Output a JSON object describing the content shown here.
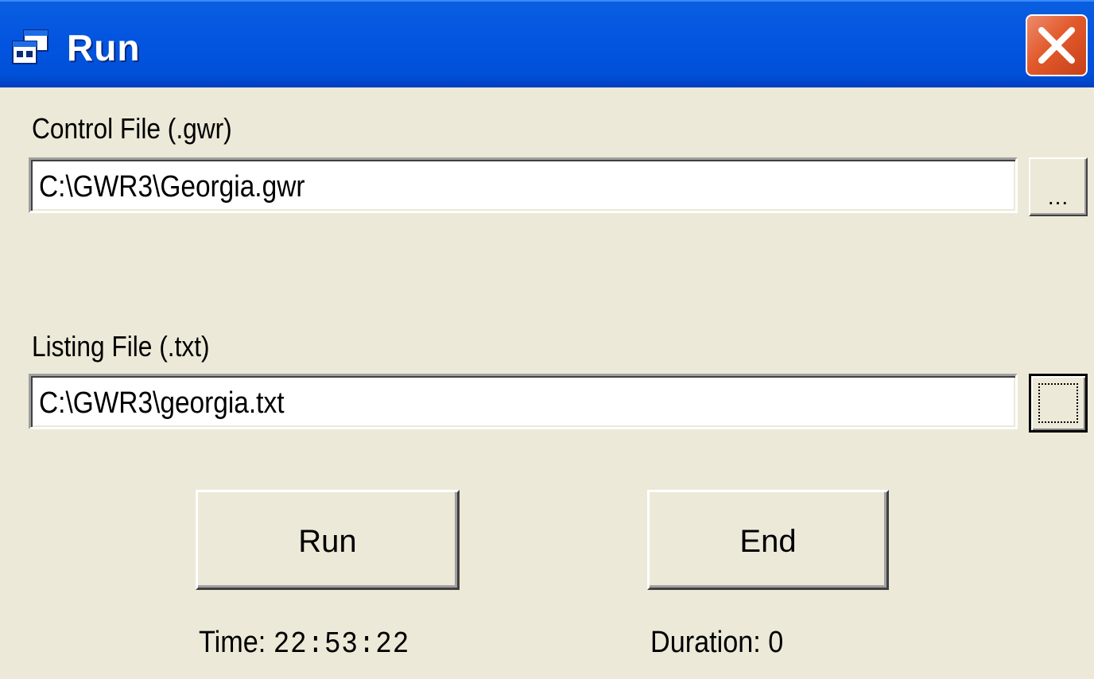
{
  "window": {
    "title": "Run",
    "icon": "app-window-icon",
    "close_icon": "close-icon"
  },
  "control_file": {
    "label": "Control File (.gwr)",
    "value": "C:\\GWR3\\Georgia.gwr",
    "browse_label": "..."
  },
  "listing_file": {
    "label": "Listing File (.txt)",
    "value": "C:\\GWR3\\georgia.txt",
    "browse_label": "..."
  },
  "buttons": {
    "run_label": "Run",
    "end_label": "End"
  },
  "status": {
    "time_label": "Time:",
    "time_value": "22:53:22",
    "duration_label": "Duration:",
    "duration_value": "0"
  },
  "colors": {
    "titlebar": "#0355e0",
    "dialog_bg": "#ece9d8",
    "close_button": "#e25a2b"
  }
}
